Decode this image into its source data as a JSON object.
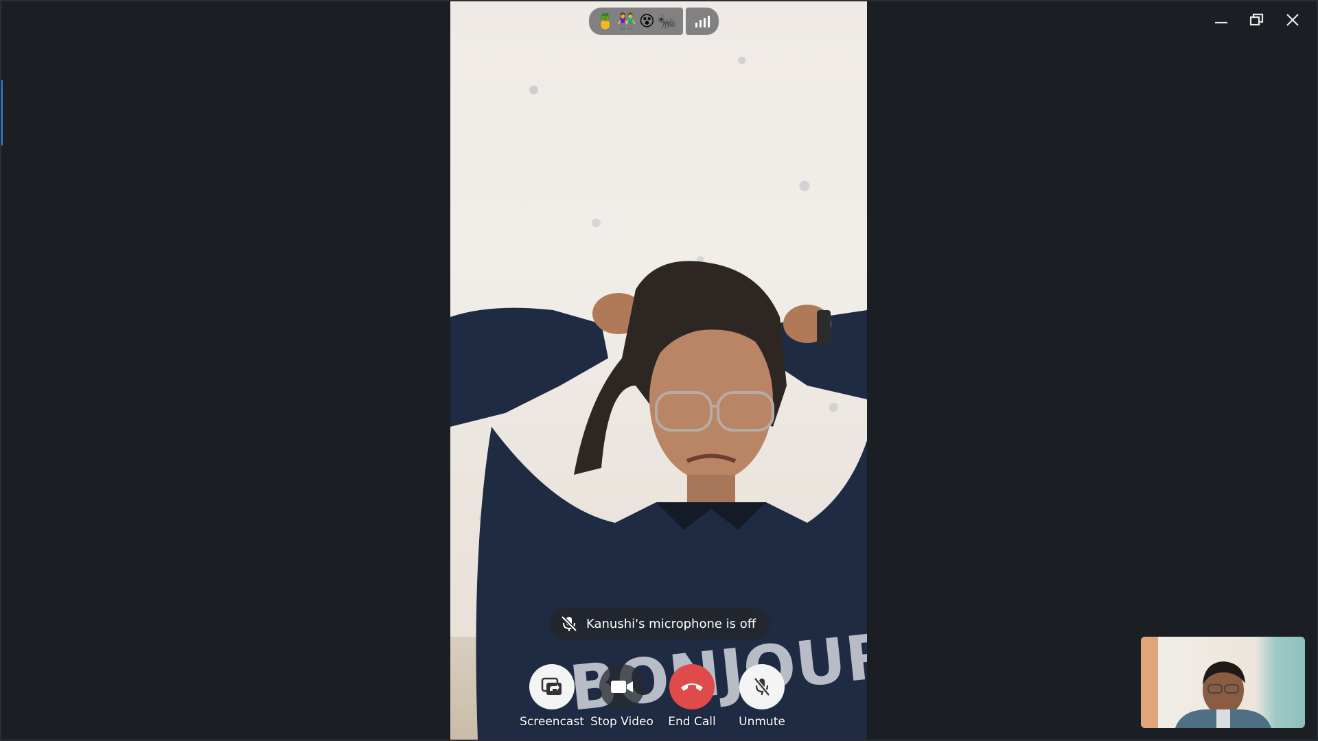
{
  "window": {
    "controls": [
      "minimize",
      "restore",
      "close"
    ]
  },
  "call": {
    "status_emojis": [
      "🍍",
      "👫",
      "😵",
      "🐜"
    ],
    "signal_icon": "signal-bars-icon",
    "toast_text": "Kanushi's microphone is off",
    "buttons": [
      {
        "label": "Screencast",
        "icon": "screencast-icon"
      },
      {
        "label": "Stop Video",
        "icon": "video-camera-icon"
      },
      {
        "label": "End Call",
        "icon": "phone-hangup-icon"
      },
      {
        "label": "Unmute",
        "icon": "mic-off-icon"
      }
    ],
    "colors": {
      "background": "#1b1e23",
      "end_call": "#e04a4a",
      "accent": "#2f7fd6"
    }
  }
}
